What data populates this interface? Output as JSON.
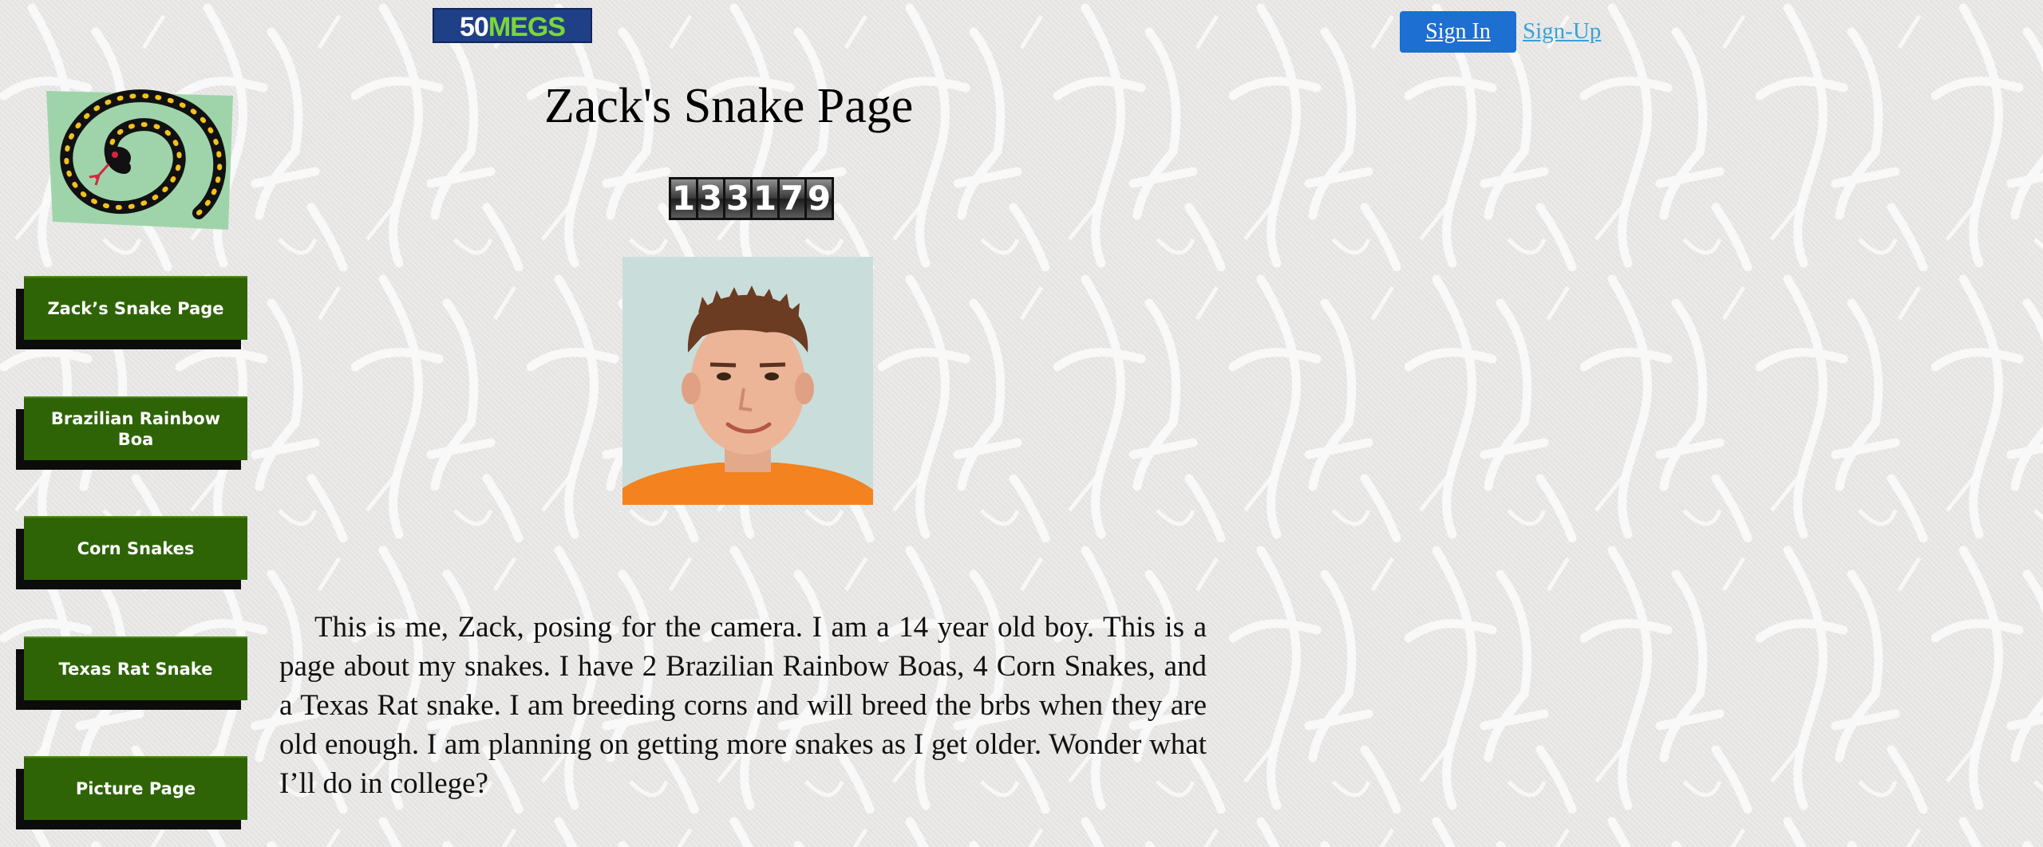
{
  "host_logo": {
    "part1": "50",
    "part2": "MEGS"
  },
  "auth": {
    "sign_in": "Sign In",
    "sign_up": "Sign-Up"
  },
  "page_title": "Zack's Snake Page",
  "hit_counter": [
    "1",
    "3",
    "3",
    "1",
    "7",
    "9"
  ],
  "nav": [
    {
      "label": "Zack’s Snake Page"
    },
    {
      "label": "Brazilian Rainbow Boa"
    },
    {
      "label": "Corn Snakes"
    },
    {
      "label": "Texas Rat Snake"
    },
    {
      "label": "Picture Page"
    }
  ],
  "bio": "This is me, Zack, posing for the camera. I am a 14 year old boy. This is a page about my snakes. I have 2 Brazilian Rainbow Boas, 4 Corn Snakes, and a Texas Rat snake. I am breeding corns and will breed the brbs when they are old enough. I am planning on getting more snakes as I get older. Wonder what I’ll do in college?",
  "colors": {
    "nav_button": "#2f6406",
    "nav_shadow": "#0c0c0c",
    "sign_in_button": "#1d6fd1",
    "sign_up_link": "#3aa1d6",
    "snake_logo_bg": "#9fd4ab",
    "background": "#ecebea"
  },
  "icons": {
    "logo": "coiled-snake-icon"
  }
}
